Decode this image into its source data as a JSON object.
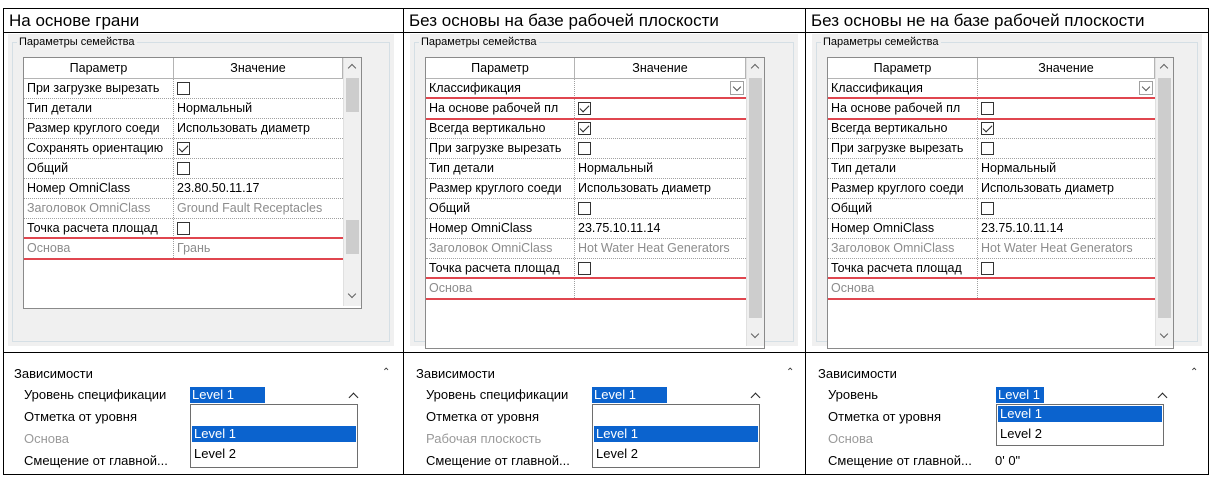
{
  "headings": [
    "На основе грани",
    "Без основы на базе рабочей плоскости",
    "Без основы не на базе рабочей плоскости"
  ],
  "panels": [
    {
      "legend": "Параметры семейства",
      "col_param": "Параметр",
      "col_value": "Значение",
      "rows": [
        {
          "param": "При загрузке вырезать",
          "type": "checkbox",
          "checked": false
        },
        {
          "param": "Тип детали",
          "type": "text",
          "value": "Нормальный"
        },
        {
          "param": "Размер круглого соеди",
          "type": "text",
          "value": "Использовать диаметр"
        },
        {
          "param": "Сохранять ориентацию",
          "type": "checkbox",
          "checked": true
        },
        {
          "param": "Общий",
          "type": "checkbox",
          "checked": false
        },
        {
          "param": "Номер OmniClass",
          "type": "text",
          "value": "23.80.50.11.17"
        },
        {
          "param": "Заголовок OmniClass",
          "type": "text",
          "value": "Ground Fault Receptacles",
          "grey": true
        },
        {
          "param": "Точка расчета площад",
          "type": "checkbox",
          "checked": false
        },
        {
          "param": "Основа",
          "type": "text",
          "value": "Грань",
          "grey": true,
          "highlight": true
        }
      ],
      "dependencies": {
        "title": "Зависимости",
        "labels": [
          "Уровень спецификации",
          "Отметка от уровня",
          "Основа",
          "Смещение от главной..."
        ],
        "selected": "Level 1",
        "options": [
          "Level 1",
          "Level 2"
        ],
        "active_option": "Level 1",
        "offset_value": ""
      }
    },
    {
      "legend": "Параметры семейства",
      "col_param": "Параметр",
      "col_value": "Значение",
      "rows": [
        {
          "param": "Классификация",
          "type": "combo",
          "value": ""
        },
        {
          "param": "На основе рабочей пл",
          "type": "checkbox",
          "checked": true,
          "highlight": true
        },
        {
          "param": "Всегда вертикально",
          "type": "checkbox",
          "checked": true
        },
        {
          "param": "При загрузке вырезать",
          "type": "checkbox",
          "checked": false
        },
        {
          "param": "Тип детали",
          "type": "text",
          "value": "Нормальный"
        },
        {
          "param": "Размер круглого соеди",
          "type": "text",
          "value": "Использовать диаметр"
        },
        {
          "param": "Общий",
          "type": "checkbox",
          "checked": false
        },
        {
          "param": "Номер OmniClass",
          "type": "text",
          "value": "23.75.10.11.14"
        },
        {
          "param": "Заголовок OmniClass",
          "type": "text",
          "value": "Hot Water Heat Generators",
          "grey": true
        },
        {
          "param": "Точка расчета площад",
          "type": "checkbox",
          "checked": false
        },
        {
          "param": "Основа",
          "type": "text",
          "value": "",
          "grey": true,
          "highlight": true
        }
      ],
      "dependencies": {
        "title": "Зависимости",
        "labels": [
          "Уровень спецификации",
          "Отметка от уровня",
          "Рабочая плоскость",
          "Смещение от главной..."
        ],
        "selected": "Level 1",
        "options": [
          "Level 1",
          "Level 2"
        ],
        "active_option": "Level 1",
        "offset_value": ""
      }
    },
    {
      "legend": "Параметры семейства",
      "col_param": "Параметр",
      "col_value": "Значение",
      "rows": [
        {
          "param": "Классификация",
          "type": "combo",
          "value": ""
        },
        {
          "param": "На основе рабочей пл",
          "type": "checkbox",
          "checked": false,
          "highlight": true
        },
        {
          "param": "Всегда вертикально",
          "type": "checkbox",
          "checked": true
        },
        {
          "param": "При загрузке вырезать",
          "type": "checkbox",
          "checked": false
        },
        {
          "param": "Тип детали",
          "type": "text",
          "value": "Нормальный"
        },
        {
          "param": "Размер круглого соеди",
          "type": "text",
          "value": "Использовать диаметр"
        },
        {
          "param": "Общий",
          "type": "checkbox",
          "checked": false
        },
        {
          "param": "Номер OmniClass",
          "type": "text",
          "value": "23.75.10.11.14"
        },
        {
          "param": "Заголовок OmniClass",
          "type": "text",
          "value": "Hot Water Heat Generators",
          "grey": true
        },
        {
          "param": "Точка расчета площад",
          "type": "checkbox",
          "checked": false
        },
        {
          "param": "Основа",
          "type": "text",
          "value": "",
          "grey": true,
          "highlight": true
        }
      ],
      "dependencies": {
        "title": "Зависимости",
        "labels": [
          "Уровень",
          "Отметка от уровня",
          "Основа",
          "Смещение от главной..."
        ],
        "selected": "Level 1",
        "options": [
          "Level 1",
          "Level 2"
        ],
        "active_option": "Level 1",
        "offset_value": "0'  0\""
      }
    }
  ],
  "colors": {
    "highlight": "#e0464f",
    "selection": "#0b63ce",
    "panel_bg": "#f0f0f0"
  }
}
